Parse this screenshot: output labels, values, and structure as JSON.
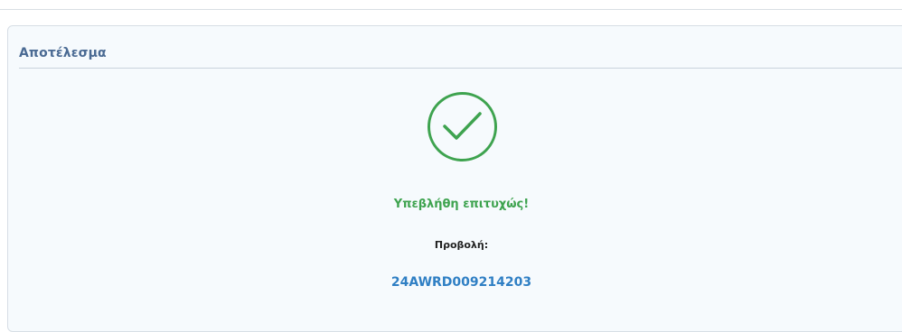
{
  "panel": {
    "title": "Αποτέλεσμα"
  },
  "result": {
    "icon": "check-circle-icon",
    "success_message": "Υπεβλήθη επιτυχώς!",
    "view_label": "Προβολή:",
    "protocol_number": "24AWRD009214203",
    "colors": {
      "success": "#3ea34f",
      "link": "#2f7fc4",
      "title": "#4a6a93"
    }
  }
}
